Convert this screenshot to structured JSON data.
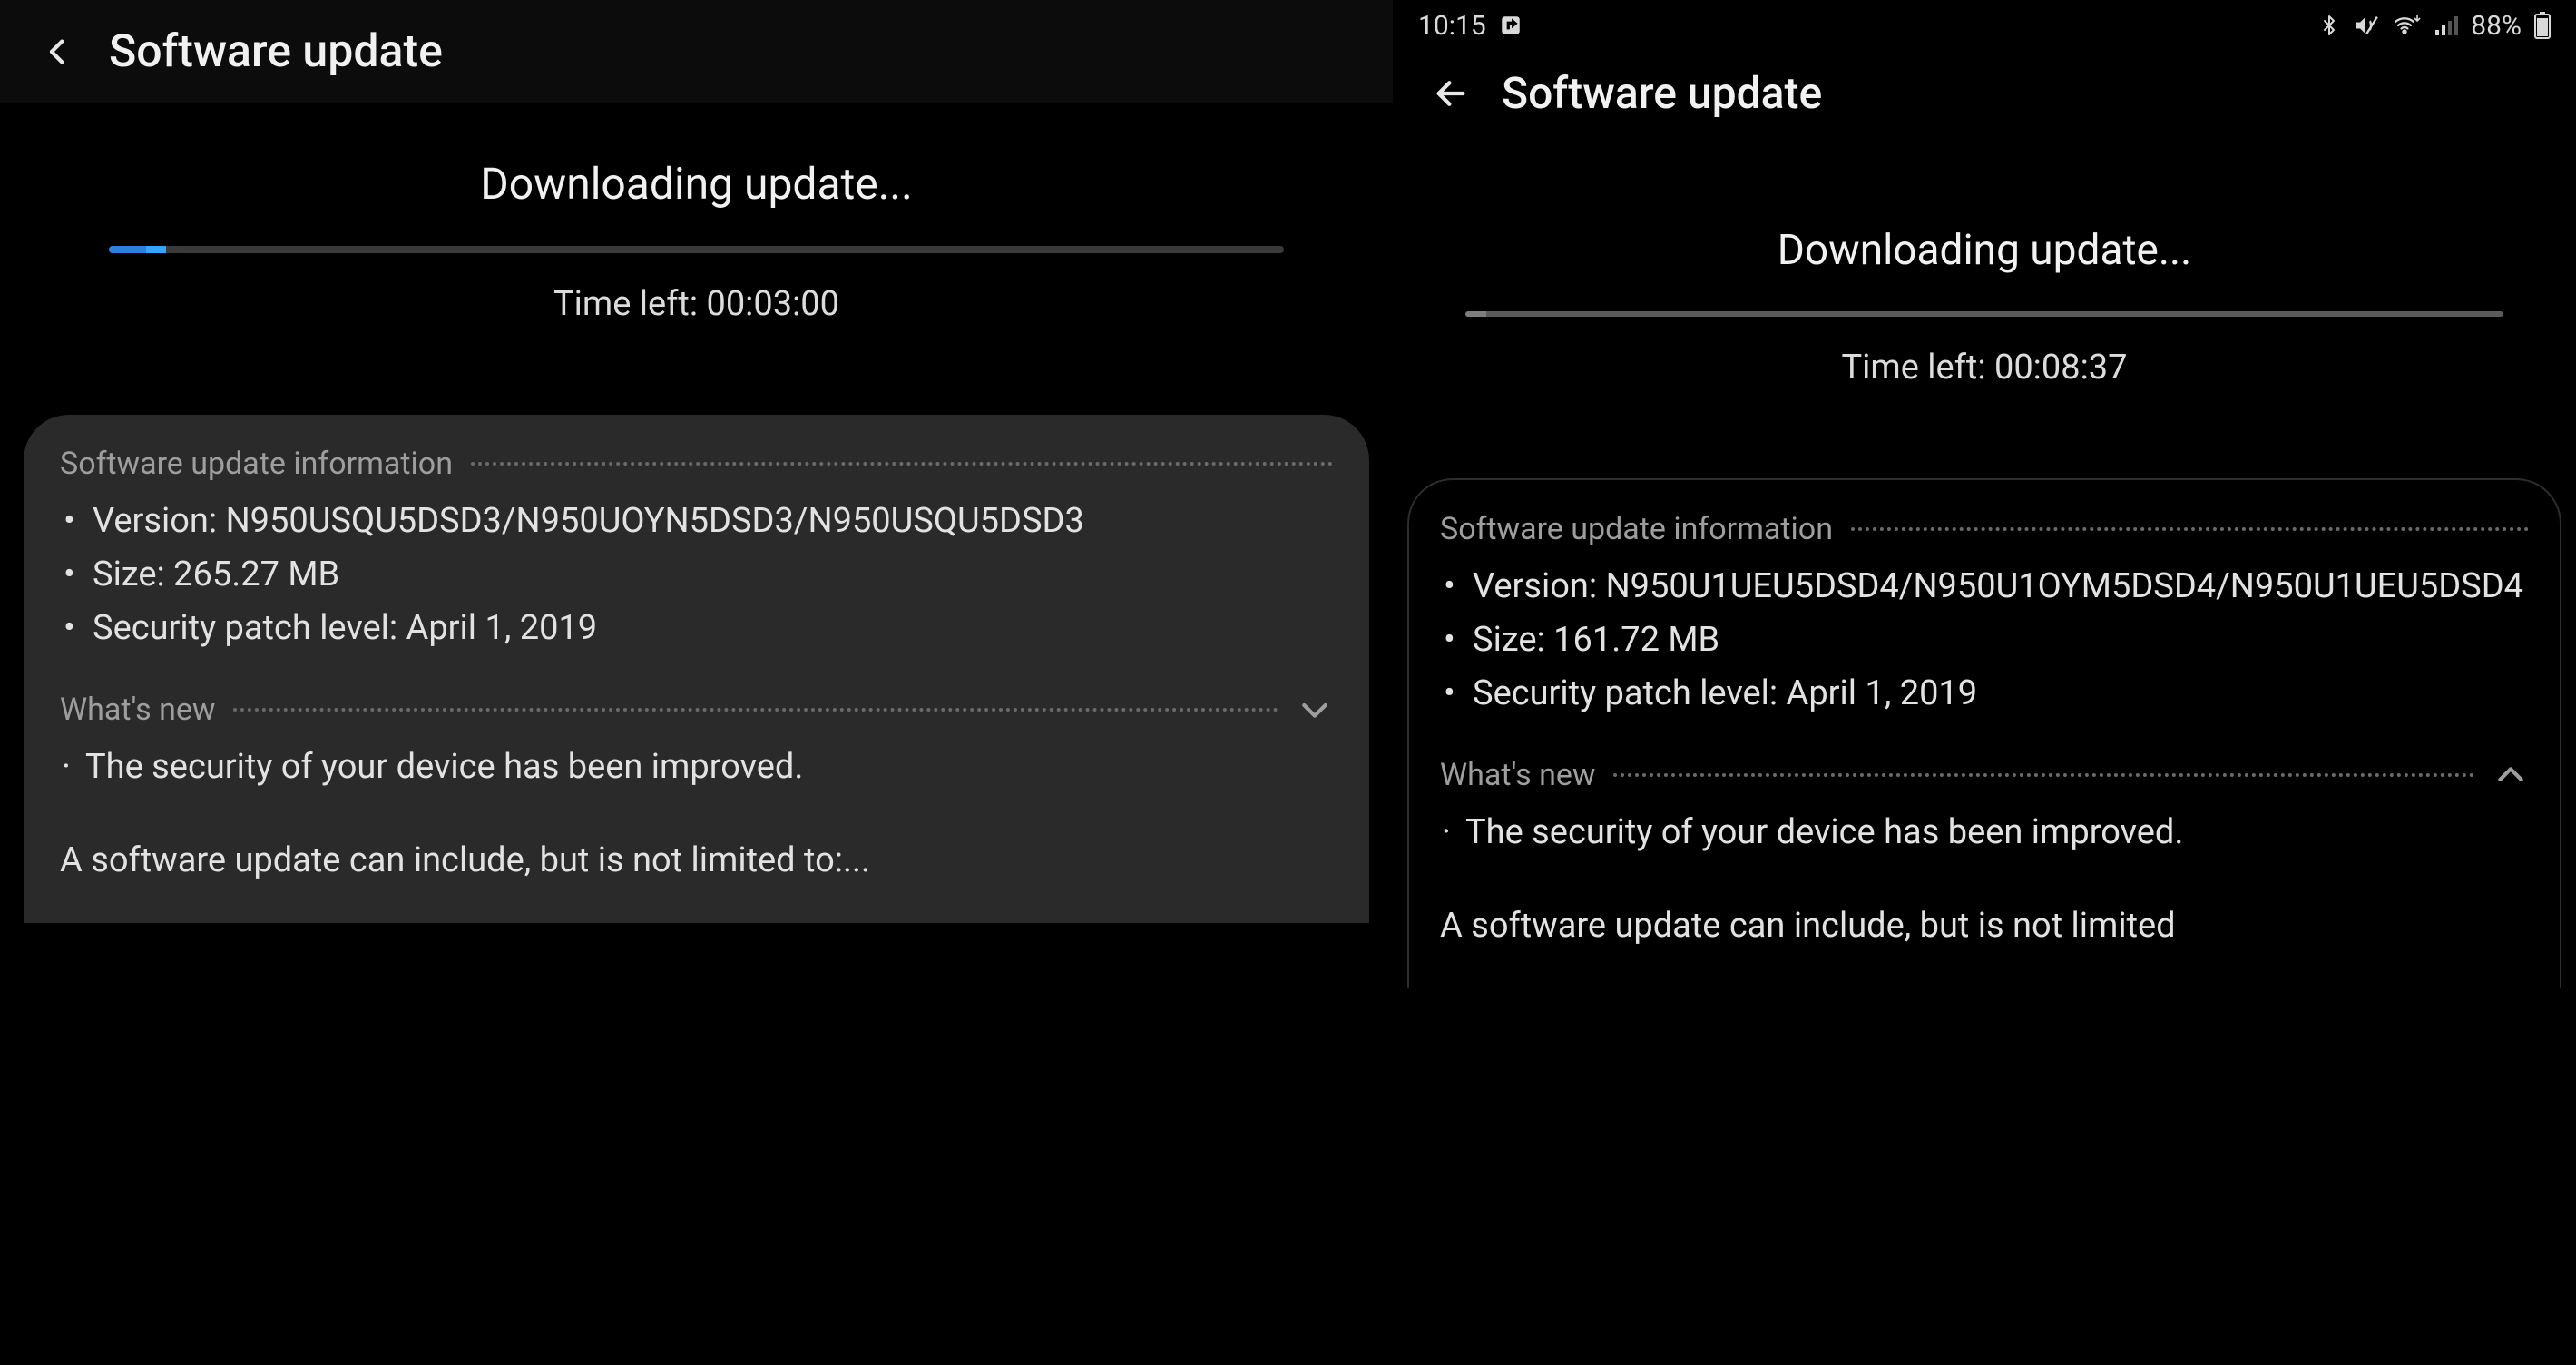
{
  "left": {
    "appbar": {
      "title": "Software update"
    },
    "download": {
      "title": "Downloading update...",
      "progress_pct": 4,
      "time_left_label": "Time left: ",
      "time_left_value": "00:03:00"
    },
    "info": {
      "header": "Software update information",
      "version_label": "Version",
      "version_value": "N950USQU5DSD3/N950UOYN5DSD3/N950USQU5DSD3",
      "size_label": "Size",
      "size_value": "265.27 MB",
      "patch_label": "Security patch level",
      "patch_value": "April 1, 2019"
    },
    "whatsnew": {
      "header": "What's new",
      "line1": "The security of your device has been improved.",
      "extra": "A software update can include, but is not limited to:..."
    }
  },
  "right": {
    "statusbar": {
      "time": "10:15",
      "battery_pct": "88%"
    },
    "appbar": {
      "title": "Software update"
    },
    "download": {
      "title": "Downloading update...",
      "progress_pct": 2,
      "time_left_label": "Time left: ",
      "time_left_value": "00:08:37"
    },
    "info": {
      "header": "Software update information",
      "version_label": "Version",
      "version_value": "N950U1UEU5DSD4/N950U1OYM5DSD4/N950U1UEU5DSD4",
      "size_label": "Size",
      "size_value": "161.72 MB",
      "patch_label": "Security patch level",
      "patch_value": "April 1, 2019"
    },
    "whatsnew": {
      "header": "What's new",
      "line1": "The security of your device has been improved.",
      "extra": "A software update can include, but is not limited"
    }
  }
}
